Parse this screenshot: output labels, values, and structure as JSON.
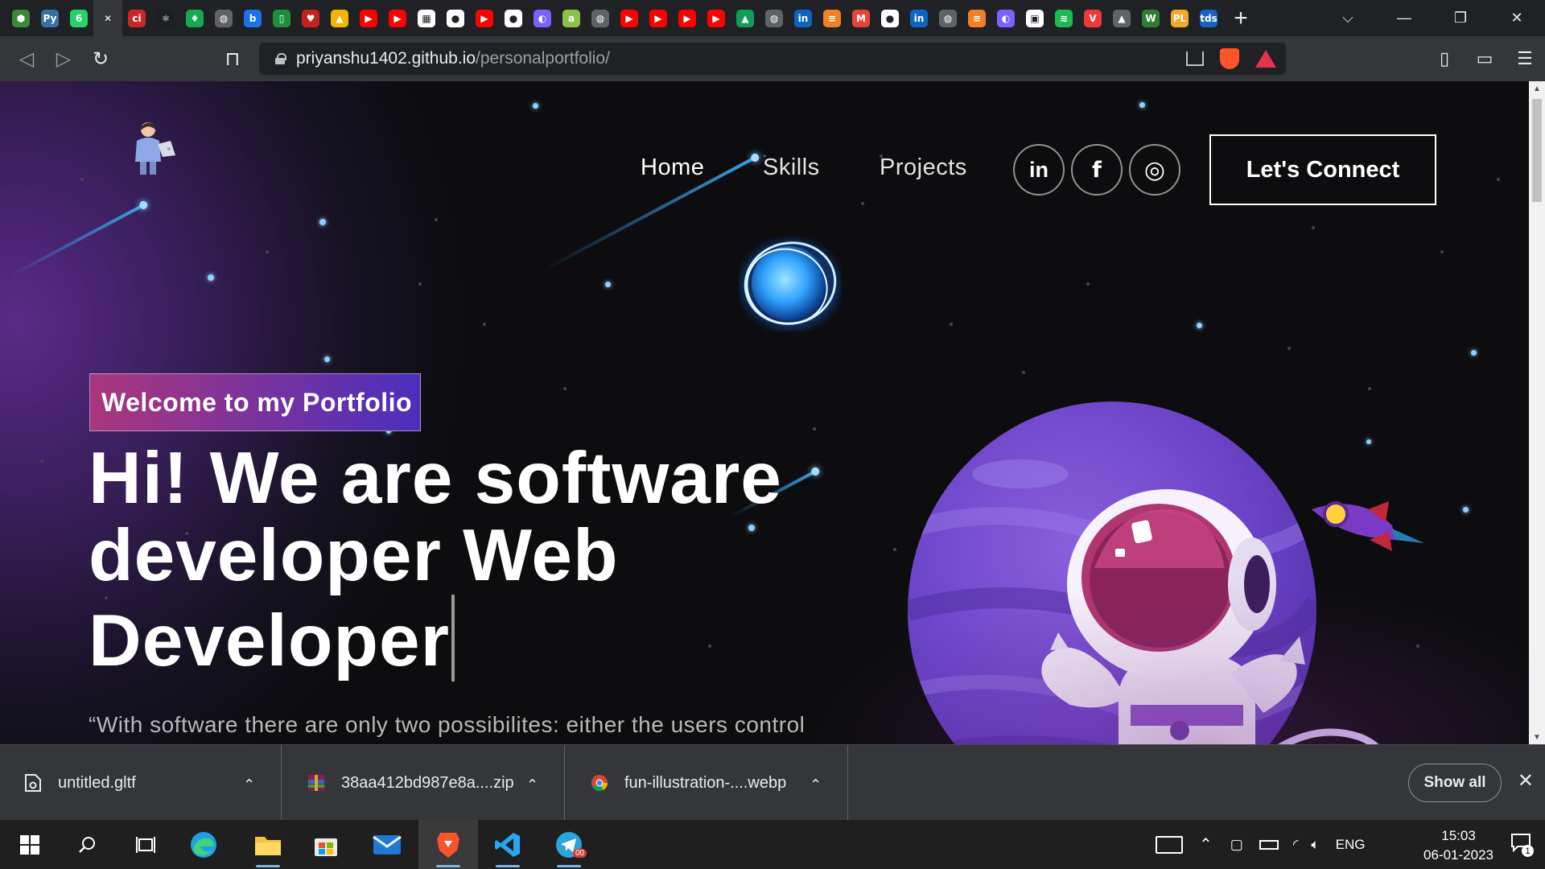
{
  "browser": {
    "url_host": "priyanshu1402.github.io",
    "url_path": "/personalportfolio/",
    "tabs": [
      {
        "icon": "hexagon",
        "color": "#3c873a",
        "glyph": "⬢"
      },
      {
        "icon": "python",
        "color": "#3572a5",
        "glyph": "Py"
      },
      {
        "icon": "whatsapp",
        "color": "#25d366",
        "glyph": "6"
      },
      {
        "icon": "close-active-tab",
        "color": "#35363a",
        "glyph": "✕"
      },
      {
        "icon": "ci",
        "color": "#c62828",
        "glyph": "ci"
      },
      {
        "icon": "react",
        "color": "#1b1f24",
        "glyph": "⚛"
      },
      {
        "icon": "mongo",
        "color": "#13aa52",
        "glyph": "♦"
      },
      {
        "icon": "globe",
        "color": "#5f6368",
        "glyph": "◍"
      },
      {
        "icon": "b",
        "color": "#1a73e8",
        "glyph": "b"
      },
      {
        "icon": "doc",
        "color": "#1e8e3e",
        "glyph": "▯"
      },
      {
        "icon": "heart",
        "color": "#c5221f",
        "glyph": "♥"
      },
      {
        "icon": "drive",
        "color": "#f4b400",
        "glyph": "▲"
      },
      {
        "icon": "youtube",
        "color": "#ff0000",
        "glyph": "▶"
      },
      {
        "icon": "youtube",
        "color": "#ff0000",
        "glyph": "▶"
      },
      {
        "icon": "calendar",
        "color": "#ffffff",
        "glyph": "▦"
      },
      {
        "icon": "github",
        "color": "#ffffff",
        "glyph": "●"
      },
      {
        "icon": "youtube",
        "color": "#ff0000",
        "glyph": "▶"
      },
      {
        "icon": "github",
        "color": "#ffffff",
        "glyph": "●"
      },
      {
        "icon": "color",
        "color": "#7b61ff",
        "glyph": "◐"
      },
      {
        "icon": "a",
        "color": "#8bc34a",
        "glyph": "a"
      },
      {
        "icon": "globe",
        "color": "#5f6368",
        "glyph": "◍"
      },
      {
        "icon": "youtube",
        "color": "#ff0000",
        "glyph": "▶"
      },
      {
        "icon": "youtube",
        "color": "#ff0000",
        "glyph": "▶"
      },
      {
        "icon": "youtube",
        "color": "#ff0000",
        "glyph": "▶"
      },
      {
        "icon": "youtube",
        "color": "#ff0000",
        "glyph": "▶"
      },
      {
        "icon": "drive",
        "color": "#0f9d58",
        "glyph": "▲"
      },
      {
        "icon": "globe",
        "color": "#5f6368",
        "glyph": "◍"
      },
      {
        "icon": "linkedin",
        "color": "#0a66c2",
        "glyph": "in"
      },
      {
        "icon": "stack",
        "color": "#f48024",
        "glyph": "≡"
      },
      {
        "icon": "gmail",
        "color": "#ea4335",
        "glyph": "M"
      },
      {
        "icon": "github",
        "color": "#ffffff",
        "glyph": "●"
      },
      {
        "icon": "linkedin",
        "color": "#0a66c2",
        "glyph": "in"
      },
      {
        "icon": "globe",
        "color": "#5f6368",
        "glyph": "◍"
      },
      {
        "icon": "stack",
        "color": "#f48024",
        "glyph": "≡"
      },
      {
        "icon": "color",
        "color": "#7b61ff",
        "glyph": "◐"
      },
      {
        "icon": "news",
        "color": "#ffffff",
        "glyph": "▣"
      },
      {
        "icon": "spotify",
        "color": "#1db954",
        "glyph": "≋"
      },
      {
        "icon": "vivaldi",
        "color": "#ef3939",
        "glyph": "V"
      },
      {
        "icon": "mountain",
        "color": "#5f6368",
        "glyph": "▲"
      },
      {
        "icon": "w",
        "color": "#2e7d32",
        "glyph": "W"
      },
      {
        "icon": "pl",
        "color": "#f9a825",
        "glyph": "PL"
      },
      {
        "icon": "tds",
        "color": "#1565c0",
        "glyph": "tds"
      }
    ]
  },
  "site": {
    "nav": {
      "home": "Home",
      "skills": "Skills",
      "projects": "Projects"
    },
    "social": {
      "linkedin": "in",
      "facebook": "f",
      "instagram": "◎"
    },
    "connect_label": "Let's Connect",
    "tagline": "Welcome to my Portfolio",
    "headline_line1": "Hi! We are software",
    "headline_line2": "developer Web",
    "headline_line3": "Developer",
    "quote": "“With software there are only two possibilites: either the users control"
  },
  "downloads": {
    "items": [
      {
        "name": "untitled.gltf",
        "icon": "file-icon"
      },
      {
        "name": "38aa412bd987e8a....zip",
        "icon": "archive-icon"
      },
      {
        "name": "fun-illustration-....webp",
        "icon": "chrome-icon"
      }
    ],
    "show_all": "Show all"
  },
  "taskbar": {
    "time": "15:03",
    "date": "06-01-2023",
    "lang": "ENG",
    "notif_count": "1",
    "telegram_badge": "00"
  }
}
